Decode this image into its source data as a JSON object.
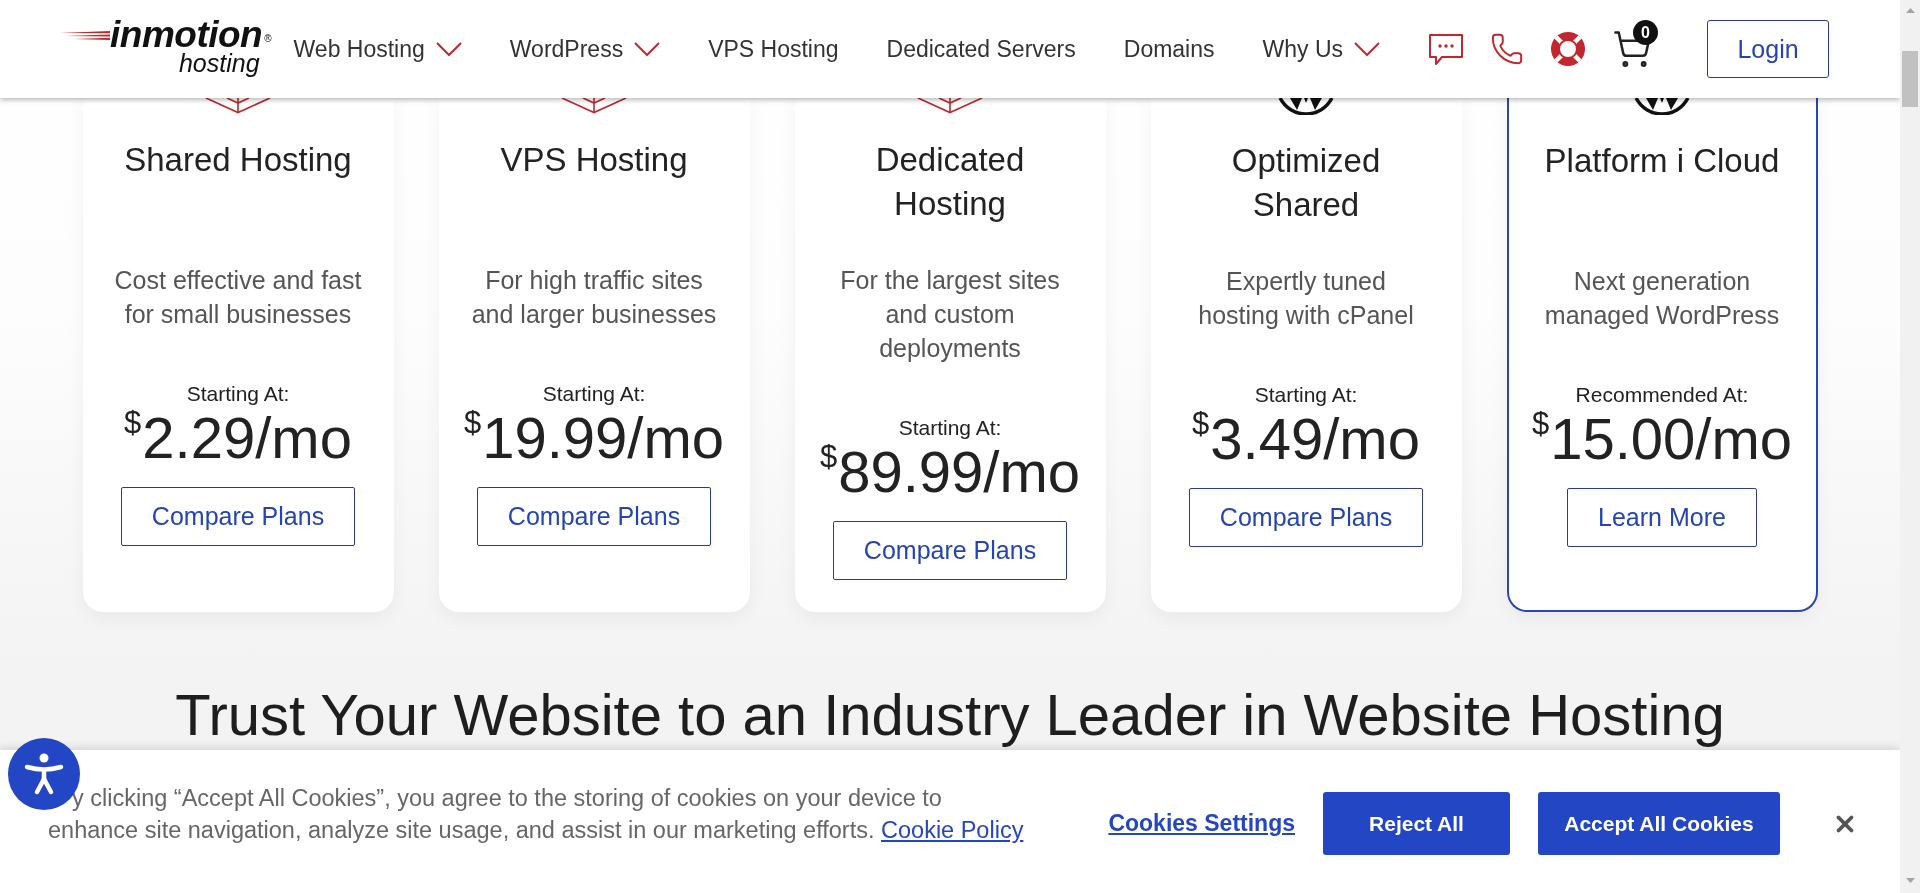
{
  "header": {
    "logo": {
      "wordmark": "inmotion",
      "mark": "®",
      "tagline": "hosting"
    },
    "nav": [
      {
        "label": "Web Hosting",
        "dropdown": true
      },
      {
        "label": "WordPress",
        "dropdown": true
      },
      {
        "label": "VPS Hosting",
        "dropdown": false
      },
      {
        "label": "Dedicated Servers",
        "dropdown": false
      },
      {
        "label": "Domains",
        "dropdown": false
      },
      {
        "label": "Why Us",
        "dropdown": true
      }
    ],
    "cart_count": "0",
    "login": "Login"
  },
  "plans": [
    {
      "kind": "cube",
      "title": "Shared Hosting",
      "description": "Cost effective and fast\nfor small businesses",
      "price_label": "Starting At:",
      "currency": "$",
      "amount": "2.29",
      "period": "/mo",
      "button": "Compare Plans",
      "featured": false
    },
    {
      "kind": "cube",
      "title": "VPS Hosting",
      "description": "For high traffic sites\nand larger businesses",
      "price_label": "Starting At:",
      "currency": "$",
      "amount": "19.99",
      "period": "/mo",
      "button": "Compare Plans",
      "featured": false
    },
    {
      "kind": "cube",
      "title": "Dedicated\nHosting",
      "description": "For the largest sites\nand custom\ndeployments",
      "price_label": "Starting At:",
      "currency": "$",
      "amount": "89.99",
      "period": "/mo",
      "button": "Compare Plans",
      "featured": false
    },
    {
      "kind": "round",
      "title": "Optimized\nShared",
      "description": "Expertly tuned\nhosting with cPanel",
      "price_label": "Starting At:",
      "currency": "$",
      "amount": "3.49",
      "period": "/mo",
      "button": "Compare Plans",
      "featured": false
    },
    {
      "kind": "round",
      "title": "Platform i Cloud",
      "description": "Next generation\nmanaged WordPress",
      "price_label": "Recommended At:",
      "currency": "$",
      "amount": "15.00",
      "period": "/mo",
      "button": "Learn More",
      "featured": true
    }
  ],
  "section_heading": "Trust Your Website to an Industry Leader in Website Hosting",
  "cookie_banner": {
    "text": "y clicking “Accept All Cookies”, you agree to the storing of cookies on your device to\nenhance site navigation, analyze site usage, and assist in our marketing efforts.",
    "link": "Cookie Policy",
    "settings": "Cookies Settings",
    "reject": "Reject All",
    "accept": "Accept All Cookies"
  }
}
